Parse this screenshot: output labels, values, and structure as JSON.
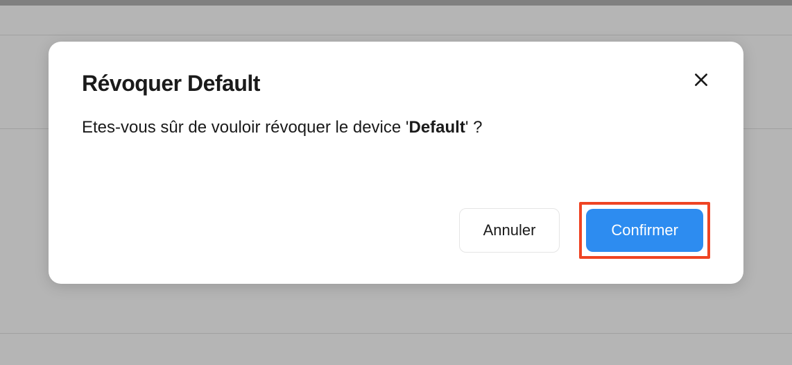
{
  "modal": {
    "title": "Révoquer Default",
    "body_prefix": "Etes-vous sûr de vouloir révoquer le device '",
    "body_bold": "Default",
    "body_suffix": "' ?",
    "cancel_label": "Annuler",
    "confirm_label": "Confirmer"
  }
}
